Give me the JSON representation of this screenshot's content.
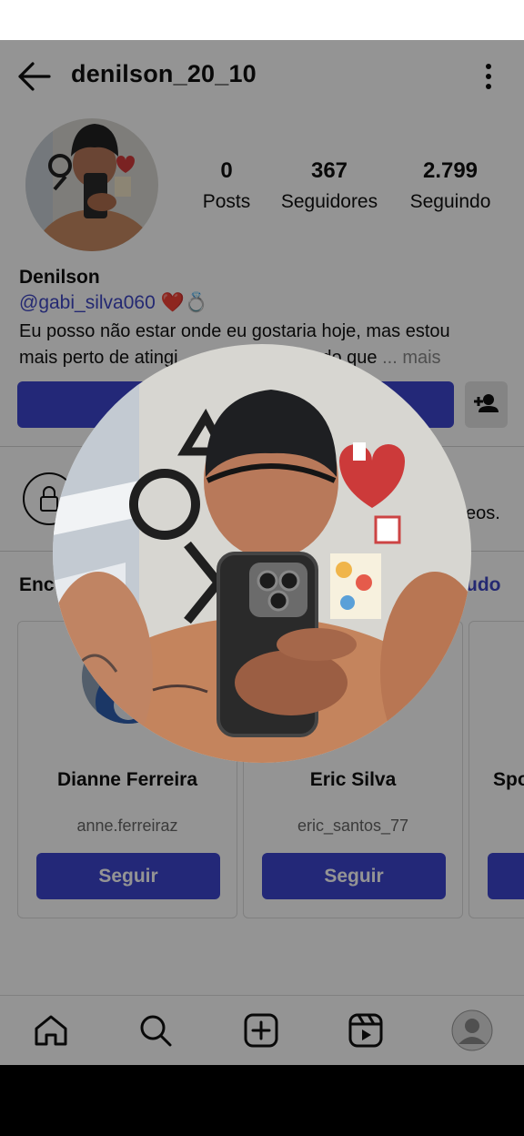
{
  "header": {
    "username": "denilson_20_10"
  },
  "profile": {
    "display_name": "Denilson",
    "mention": "@gabi_silva060",
    "mention_emoji": "❤️💍",
    "bio_line1": "Eu posso não estar onde eu gostaria hoje, mas estou",
    "bio_line2_start": "mais perto de atingi",
    "bio_line2_end": "bos do que",
    "bio_more": "... mais",
    "stats": {
      "posts_count": "0",
      "posts_label": "Posts",
      "followers_count": "367",
      "followers_label": "Seguidores",
      "following_count": "2.799",
      "following_label": "Seguindo"
    }
  },
  "private_notice": {
    "tail_text": "eos."
  },
  "discover": {
    "title": "Enc",
    "see_all": "udo",
    "cards": [
      {
        "name": "Dianne Ferreira",
        "username": "anne.ferreiraz",
        "button": "Seguir"
      },
      {
        "name": "Eric Silva",
        "username": "eric_santos_77",
        "button": "Seguir"
      },
      {
        "name": "Spo",
        "username": "",
        "button": ""
      }
    ]
  },
  "icons": {
    "back": "arrow-left-icon",
    "more": "more-vertical-icon",
    "suggest": "add-person-icon",
    "lock": "lock-icon",
    "home": "home-icon",
    "search": "search-icon",
    "create": "plus-square-icon",
    "reels": "reels-icon",
    "profile": "profile-avatar-icon"
  },
  "colors": {
    "accent": "#3d45cf",
    "link": "#3f47c4"
  }
}
